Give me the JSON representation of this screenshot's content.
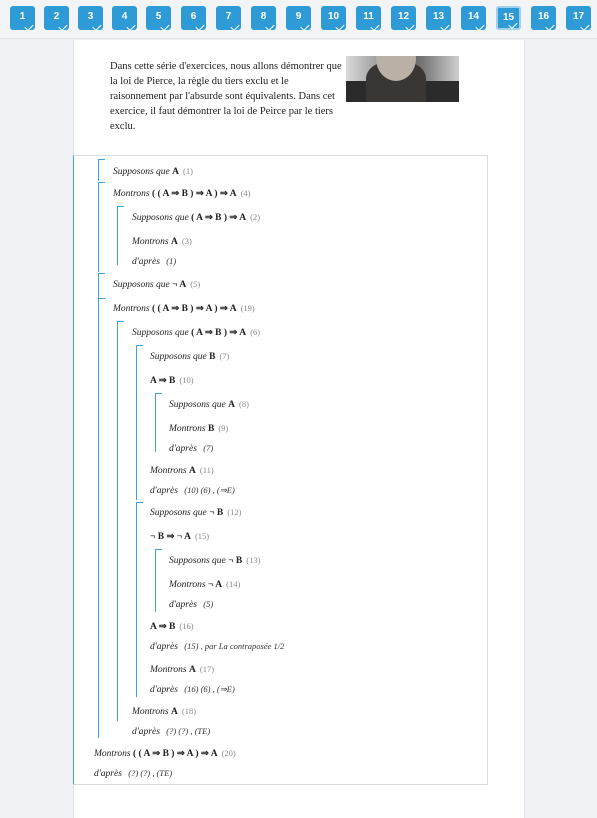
{
  "tabs": [
    {
      "label": "1",
      "active": false
    },
    {
      "label": "2",
      "active": false
    },
    {
      "label": "3",
      "active": false
    },
    {
      "label": "4",
      "active": false
    },
    {
      "label": "5",
      "active": false
    },
    {
      "label": "6",
      "active": false
    },
    {
      "label": "7",
      "active": false
    },
    {
      "label": "8",
      "active": false
    },
    {
      "label": "9",
      "active": false
    },
    {
      "label": "10",
      "active": false
    },
    {
      "label": "11",
      "active": false
    },
    {
      "label": "12",
      "active": false
    },
    {
      "label": "13",
      "active": false
    },
    {
      "label": "14",
      "active": false
    },
    {
      "label": "15",
      "active": true
    },
    {
      "label": "16",
      "active": false
    },
    {
      "label": "17",
      "active": false
    }
  ],
  "intro_text": "Dans cette série d'exercices, nous allons démontrer que la loi de Pierce, la règle du tiers exclu et le raisonnement par l'absurde sont équivalents. Dans cet exercice, il faut démontrer la loi de Peirce par le tiers exclu.",
  "proof": [
    {
      "depth": 0,
      "kw": "Supposons que",
      "f": "A",
      "n": "(1)"
    },
    {
      "depth": 0,
      "kw": "Montrons",
      "f": "( ( A ⇒ B ) ⇒ A ) ⇒ A",
      "n": "(4)"
    },
    {
      "depth": 1,
      "kw": "Supposons que",
      "f": "( A ⇒ B ) ⇒ A",
      "n": "(2)"
    },
    {
      "depth": 1,
      "kw": "Montrons",
      "f": "A",
      "n": "(3)"
    },
    {
      "depth": 1,
      "kw": "d'après",
      "f": "",
      "n": "(1)"
    },
    {
      "depth": 0,
      "kw": "Supposons que",
      "f": "¬ A",
      "n": "(5)"
    },
    {
      "depth": 0,
      "kw": "Montrons",
      "f": "( ( A ⇒ B ) ⇒ A ) ⇒ A",
      "n": "(19)"
    },
    {
      "depth": 1,
      "kw": "Supposons que",
      "f": "( A ⇒ B ) ⇒ A",
      "n": "(6)"
    },
    {
      "depth": 2,
      "kw": "Supposons que",
      "f": "B",
      "n": "(7)"
    },
    {
      "depth": 2,
      "kw": "",
      "f": "A ⇒ B",
      "n": "(10)"
    },
    {
      "depth": 3,
      "kw": "Supposons que",
      "f": "A",
      "n": "(8)"
    },
    {
      "depth": 3,
      "kw": "Montrons",
      "f": "B",
      "n": "(9)"
    },
    {
      "depth": 3,
      "kw": "d'après",
      "f": "",
      "n": "(7)"
    },
    {
      "depth": 2,
      "kw": "Montrons",
      "f": "A",
      "n": "(11)"
    },
    {
      "depth": 2,
      "kw": "d'après",
      "f": "",
      "n": "(10) (6) ,  (⇒E)"
    },
    {
      "depth": 2,
      "kw": "Supposons que",
      "f": "¬ B",
      "n": "(12)"
    },
    {
      "depth": 2,
      "kw": "",
      "f": "¬ B ⇒ ¬ A",
      "n": "(15)"
    },
    {
      "depth": 3,
      "kw": "Supposons que",
      "f": "¬ B",
      "n": "(13)"
    },
    {
      "depth": 3,
      "kw": "Montrons",
      "f": "¬ A",
      "n": "(14)"
    },
    {
      "depth": 3,
      "kw": "d'après",
      "f": "",
      "n": "(5)"
    },
    {
      "depth": 2,
      "kw": "",
      "f": "A ⇒ B",
      "n": "(16)"
    },
    {
      "depth": 2,
      "kw": "d'après",
      "f": "",
      "n": "(15) ,  par La contraposée 1/2"
    },
    {
      "depth": 2,
      "kw": "Montrons",
      "f": "A",
      "n": "(17)"
    },
    {
      "depth": 2,
      "kw": "d'après",
      "f": "",
      "n": "(16) (6) ,  (⇒E)"
    },
    {
      "depth": 1,
      "kw": "Montrons",
      "f": "A",
      "n": "(18)"
    },
    {
      "depth": 1,
      "kw": "d'après",
      "f": "",
      "n": "(?) (?) ,  (TE)"
    },
    {
      "depth": -1,
      "kw": "Montrons",
      "f": "( ( A ⇒ B ) ⇒ A ) ⇒ A",
      "n": "(20)"
    },
    {
      "depth": -1,
      "kw": "d'après",
      "f": "",
      "n": "(?) (?) ,  (TE)"
    }
  ]
}
